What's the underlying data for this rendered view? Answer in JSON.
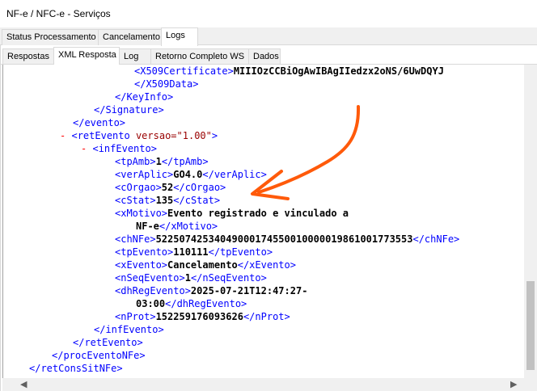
{
  "window": {
    "title": "NF-e / NFC-e - Serviços"
  },
  "tabs_main": [
    "Status Processamento",
    "Cancelamento",
    "Logs"
  ],
  "tabs_sub": [
    "Respostas",
    "XML Resposta",
    "Log",
    "Retorno Completo WS",
    "Dados"
  ],
  "xml": {
    "l1": {
      "open": "<X509Certificate>",
      "val": "MIIIOzCCBiOgAwIBAgIIedzx2oNS/6UwDQYJ"
    },
    "l2": "</X509Data>",
    "l3": "</KeyInfo>",
    "l4": "</Signature>",
    "l5": "</evento>",
    "l6": {
      "minus": "-",
      "open": "<retEvento",
      "attr": " versao=\"1.00\"",
      "close": ">"
    },
    "l7": {
      "minus": "-",
      "open": "<infEvento>"
    },
    "l8": {
      "open": "<tpAmb>",
      "val": "1",
      "close": "</tpAmb>"
    },
    "l9": {
      "open": "<verAplic>",
      "val": "GO4.0",
      "close": "</verAplic>"
    },
    "l10": {
      "open": "<cOrgao>",
      "val": "52",
      "close": "</cOrgao>"
    },
    "l11": {
      "open": "<cStat>",
      "val": "135",
      "close": "</cStat>"
    },
    "l12": {
      "open": "<xMotivo>",
      "val": "Evento registrado e vinculado a"
    },
    "l13": {
      "val": "NF-e",
      "close": "</xMotivo>"
    },
    "l14": {
      "open": "<chNFe>",
      "val": "52250742534049000174550010000019861001773553",
      "close": "</chNFe>"
    },
    "l15": {
      "open": "<tpEvento>",
      "val": "110111",
      "close": "</tpEvento>"
    },
    "l16": {
      "open": "<xEvento>",
      "val": "Cancelamento",
      "close": "</xEvento>"
    },
    "l17": {
      "open": "<nSeqEvento>",
      "val": "1",
      "close": "</nSeqEvento>"
    },
    "l18": {
      "open": "<dhRegEvento>",
      "val": "2025-07-21T12:47:27-"
    },
    "l19": {
      "val": "03:00",
      "close": "</dhRegEvento>"
    },
    "l20": {
      "open": "<nProt>",
      "val": "152259176093626",
      "close": "</nProt>"
    },
    "l21": "</infEvento>",
    "l22": "</retEvento>",
    "l23": "</procEventoNFe>",
    "l24": "</retConsSitNFe>"
  },
  "colors": {
    "tag": "#0000ff",
    "attr": "#990000",
    "collapse": "#ff0000",
    "annotation": "#ff5a0a"
  }
}
